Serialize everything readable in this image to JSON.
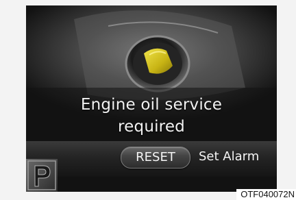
{
  "display": {
    "message_line1": "Engine oil service",
    "message_line2": "required",
    "reset_label": "RESET",
    "set_alarm_label": "Set Alarm"
  },
  "icons": {
    "oil_cap": "oil-filler-cap-icon",
    "park": "parking-p-icon"
  },
  "figure_code": "OTF040072N",
  "colors": {
    "screen_bg": "#121212",
    "text": "#f2f2f2",
    "oil_yellow": "#d4c21a",
    "page_bg": "#f3f3f3"
  }
}
